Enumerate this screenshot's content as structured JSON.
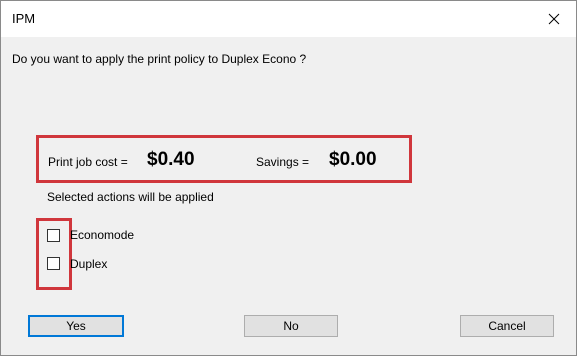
{
  "window": {
    "title": "IPM"
  },
  "dialog": {
    "question": "Do you want to apply the print policy to Duplex Econo ?",
    "print_job_cost_label": "Print job cost =",
    "print_job_cost_value": "$0.40",
    "savings_label": "Savings =",
    "savings_value": "$0.00",
    "actions_label": "Selected actions will be applied",
    "options": [
      {
        "label": "Economode",
        "checked": false
      },
      {
        "label": "Duplex",
        "checked": false
      }
    ]
  },
  "buttons": {
    "yes": "Yes",
    "no": "No",
    "cancel": "Cancel"
  },
  "icons": {
    "close": "close-icon"
  },
  "colors": {
    "highlight": "#d0363c",
    "default_button_border": "#0078d7",
    "dialog_background": "#f0f0f0"
  }
}
